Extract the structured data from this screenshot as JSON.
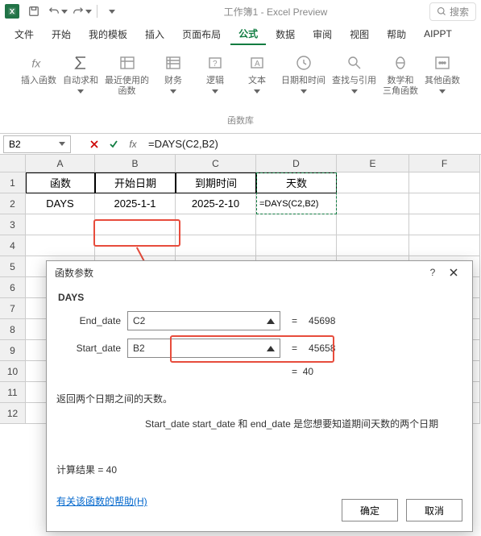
{
  "titlebar": {
    "doc": "工作簿1  -  Excel Preview",
    "search": "搜索"
  },
  "tabs": {
    "file": "文件",
    "home": "开始",
    "templates": "我的模板",
    "insert": "插入",
    "layout": "页面布局",
    "formulas": "公式",
    "data": "数据",
    "review": "审阅",
    "view": "视图",
    "help": "帮助",
    "aippt": "AIPPT"
  },
  "ribbon": {
    "fx": "插入函数",
    "sum": "自动求和",
    "recent": "最近使用的\n函数",
    "fin": "财务",
    "logic": "逻辑",
    "text": "文本",
    "date": "日期和时间",
    "lookup": "查找与引用",
    "math": "数学和\n三角函数",
    "more": "其他函数",
    "library": "函数库"
  },
  "namebox": "B2",
  "formula": "=DAYS(C2,B2)",
  "headers": {
    "A": "函数",
    "B": "开始日期",
    "C": "到期时间",
    "D": "天数"
  },
  "row2": {
    "A": "DAYS",
    "B": "2025-1-1",
    "C": "2025-2-10",
    "D": "=DAYS(C2,B2)"
  },
  "dialog": {
    "title": "函数参数",
    "fn": "DAYS",
    "arg1_label": "End_date",
    "arg1_value": "C2",
    "arg1_result": "45698",
    "arg2_label": "Start_date",
    "arg2_value": "B2",
    "arg2_result": "45658",
    "final_result": "40",
    "desc1": "返回两个日期之间的天数。",
    "desc2": "Start_date   start_date 和 end_date 是您想要知道期间天数的两个日期",
    "calc_label": "计算结果 =  40",
    "help": "有关该函数的帮助(H)",
    "ok": "确定",
    "cancel": "取消",
    "eq": "="
  }
}
